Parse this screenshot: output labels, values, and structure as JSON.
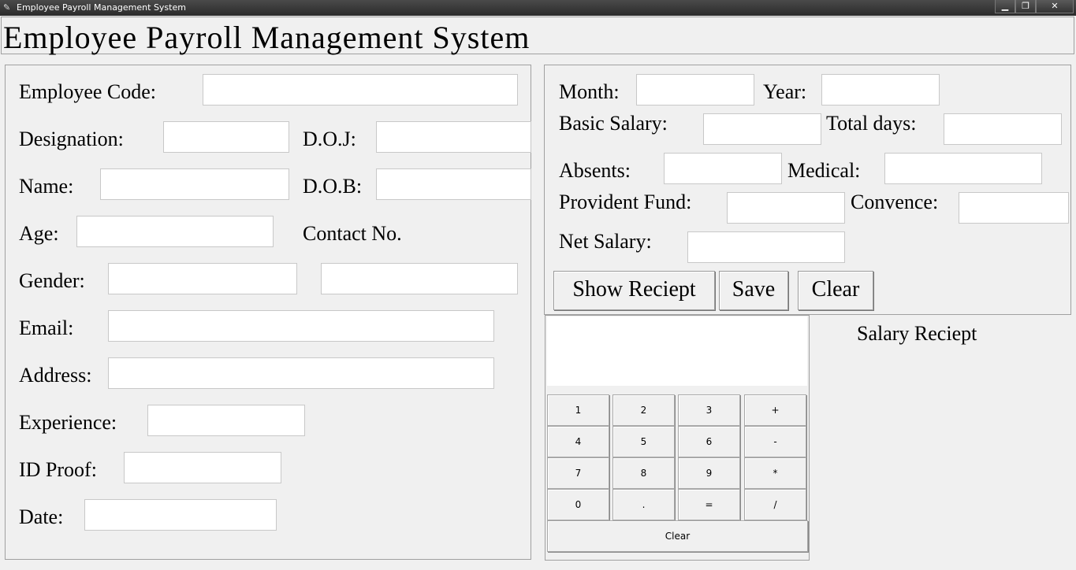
{
  "window": {
    "title": "Employee Payroll Management System",
    "minimize_glyph": "▁",
    "maximize_glyph": "❐",
    "close_glyph": "✕",
    "app_icon": "feather-icon"
  },
  "heading": "Employee Payroll Management System",
  "employee_form": {
    "employee_code_label": "Employee Code:",
    "designation_label": "Designation:",
    "doj_label": "D.O.J:",
    "name_label": "Name:",
    "dob_label": "D.O.B:",
    "age_label": "Age:",
    "contact_label": "Contact No.",
    "gender_label": "Gender:",
    "email_label": "Email:",
    "address_label": "Address:",
    "experience_label": "Experience:",
    "id_proof_label": "ID Proof:",
    "date_label": "Date:"
  },
  "salary_form": {
    "month_label": "Month:",
    "year_label": "Year:",
    "basic_salary_label": "Basic Salary:",
    "total_days_label": "Total days:",
    "absents_label": "Absents:",
    "medical_label": "Medical:",
    "provident_fund_label": "Provident Fund:",
    "convence_label": "Convence:",
    "net_salary_label": "Net Salary:",
    "show_receipt_button": "Show Reciept",
    "save_button": "Save",
    "clear_button": "Clear"
  },
  "calculator": {
    "keys": [
      "1",
      "2",
      "3",
      "+",
      "4",
      "5",
      "6",
      "-",
      "7",
      "8",
      "9",
      "*",
      "0",
      ".",
      "=",
      "/"
    ],
    "clear_label": "Clear"
  },
  "receipt": {
    "title": "Salary Reciept"
  }
}
